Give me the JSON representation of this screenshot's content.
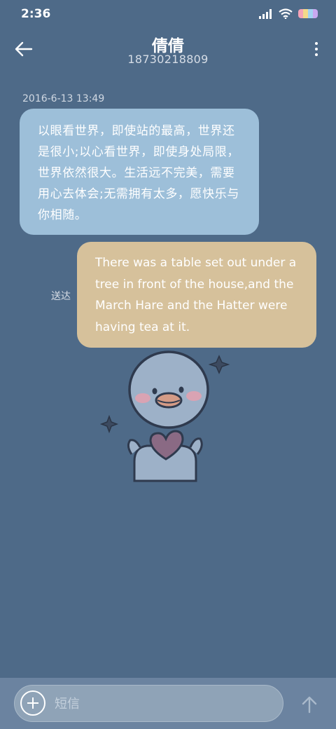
{
  "status_bar": {
    "time": "2:36",
    "battery_colors": [
      "#f4a3b8",
      "#f3d98a",
      "#a3d3f2",
      "#c9a8f1"
    ]
  },
  "header": {
    "contact_name": "倩倩",
    "contact_number": "18730218809",
    "back_icon": "arrow-left-icon",
    "more_icon": "more-vertical-icon"
  },
  "conversation": {
    "timestamp": "2016-6-13 13:49",
    "received_message": "以眼看世界，即使站的最高，世界还是很小;以心看世界，即使身处局限，世界依然很大。生活远不完美，需要用心去体会;无需拥有太多，愿快乐与你相随。",
    "sent_status": "送达",
    "sent_message": "There was a table set out under a tree in front of the house,and the March Hare and the Hatter were having tea at it."
  },
  "sticker": {
    "icon": "duck-holding-heart-sticker"
  },
  "composer": {
    "placeholder": "短信",
    "add_icon": "plus-circle-icon",
    "send_icon": "arrow-up-icon"
  },
  "colors": {
    "background": "#4e6a88",
    "received_bubble": "#9dbfd9",
    "sent_bubble": "#d6c19b",
    "composer_bar": "#6b83a0"
  }
}
